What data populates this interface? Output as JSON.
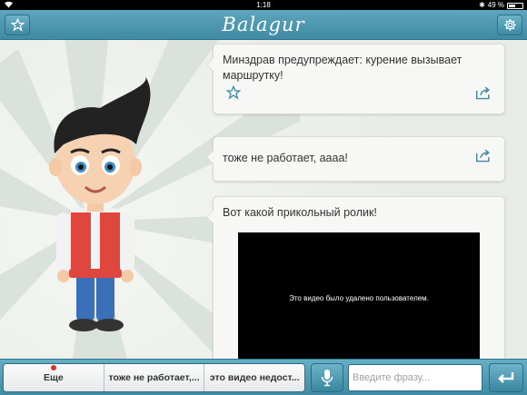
{
  "status_bar": {
    "time": "1:18",
    "battery": "49 %",
    "battery_level": 0.49
  },
  "navbar": {
    "logo": "Balagur",
    "left_icon": "star-icon",
    "right_icon": "gear-icon"
  },
  "messages": [
    {
      "text": "Минздрав предупреждает: курение вызывает маршрутку!",
      "has_star": true,
      "has_share": true
    },
    {
      "text": "тоже не работает, аааа!",
      "has_star": false,
      "has_share": true
    },
    {
      "text": "Вот какой прикольный ролик!",
      "video_text": "Это видео было удалено пользователем."
    }
  ],
  "toolbar": {
    "chips": [
      "Еще",
      "тоже не работает,...",
      "это видео недост..."
    ],
    "input_placeholder": "Введите фразу...",
    "mic_icon": "microphone-icon",
    "send_icon": "return-arrow-icon"
  },
  "colors": {
    "accent": "#4a95ae",
    "notification_dot": "#d9352b"
  }
}
